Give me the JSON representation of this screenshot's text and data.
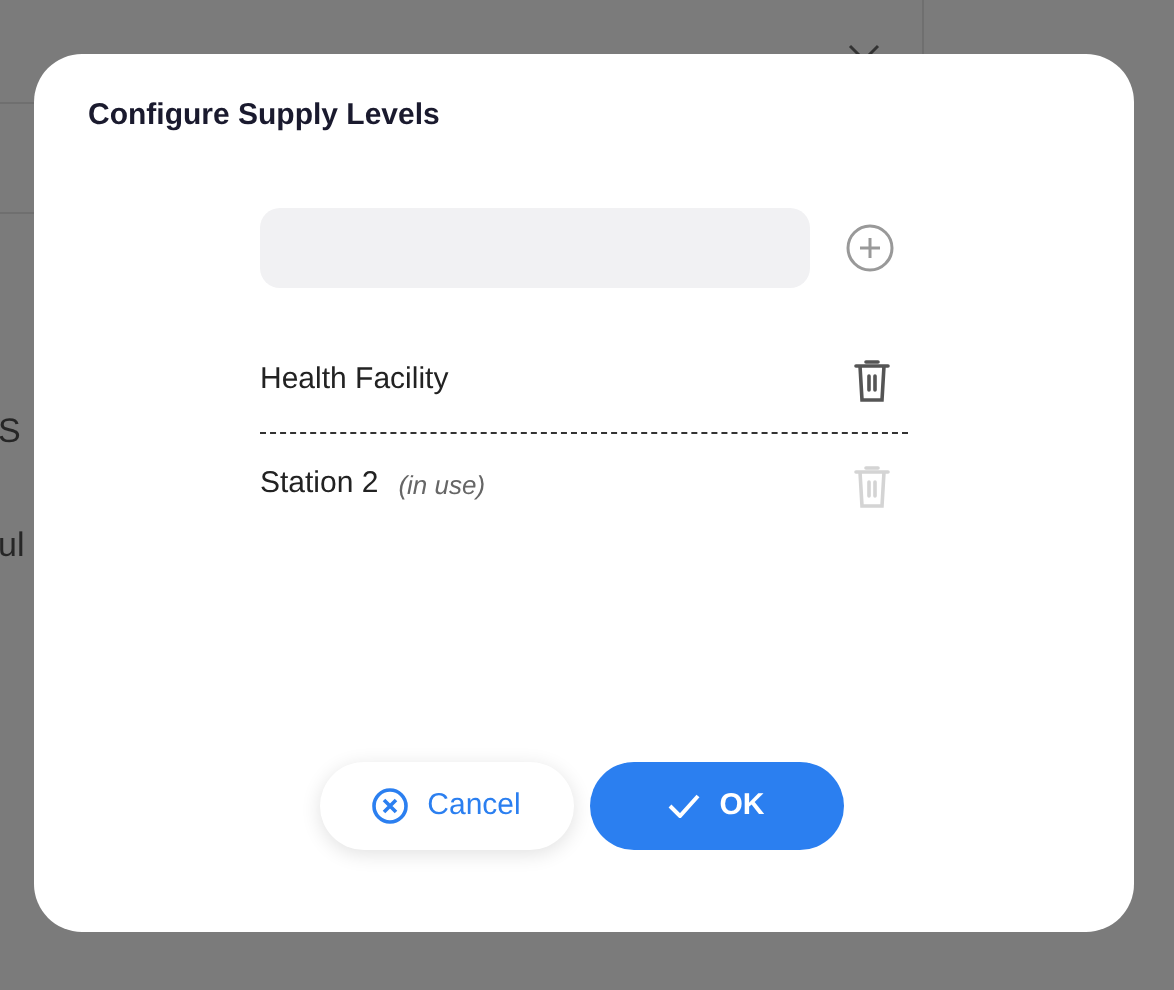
{
  "background": {
    "texts": [
      "S",
      "ul"
    ]
  },
  "dialog": {
    "title": "Configure Supply Levels",
    "levels": [
      {
        "name": "Health Facility",
        "in_use": false
      },
      {
        "name": "Station 2",
        "note": "(in use)",
        "in_use": true
      }
    ],
    "buttons": [
      {
        "kind": "cancel",
        "label": "Cancel"
      },
      {
        "kind": "ok",
        "label": "OK"
      }
    ]
  }
}
